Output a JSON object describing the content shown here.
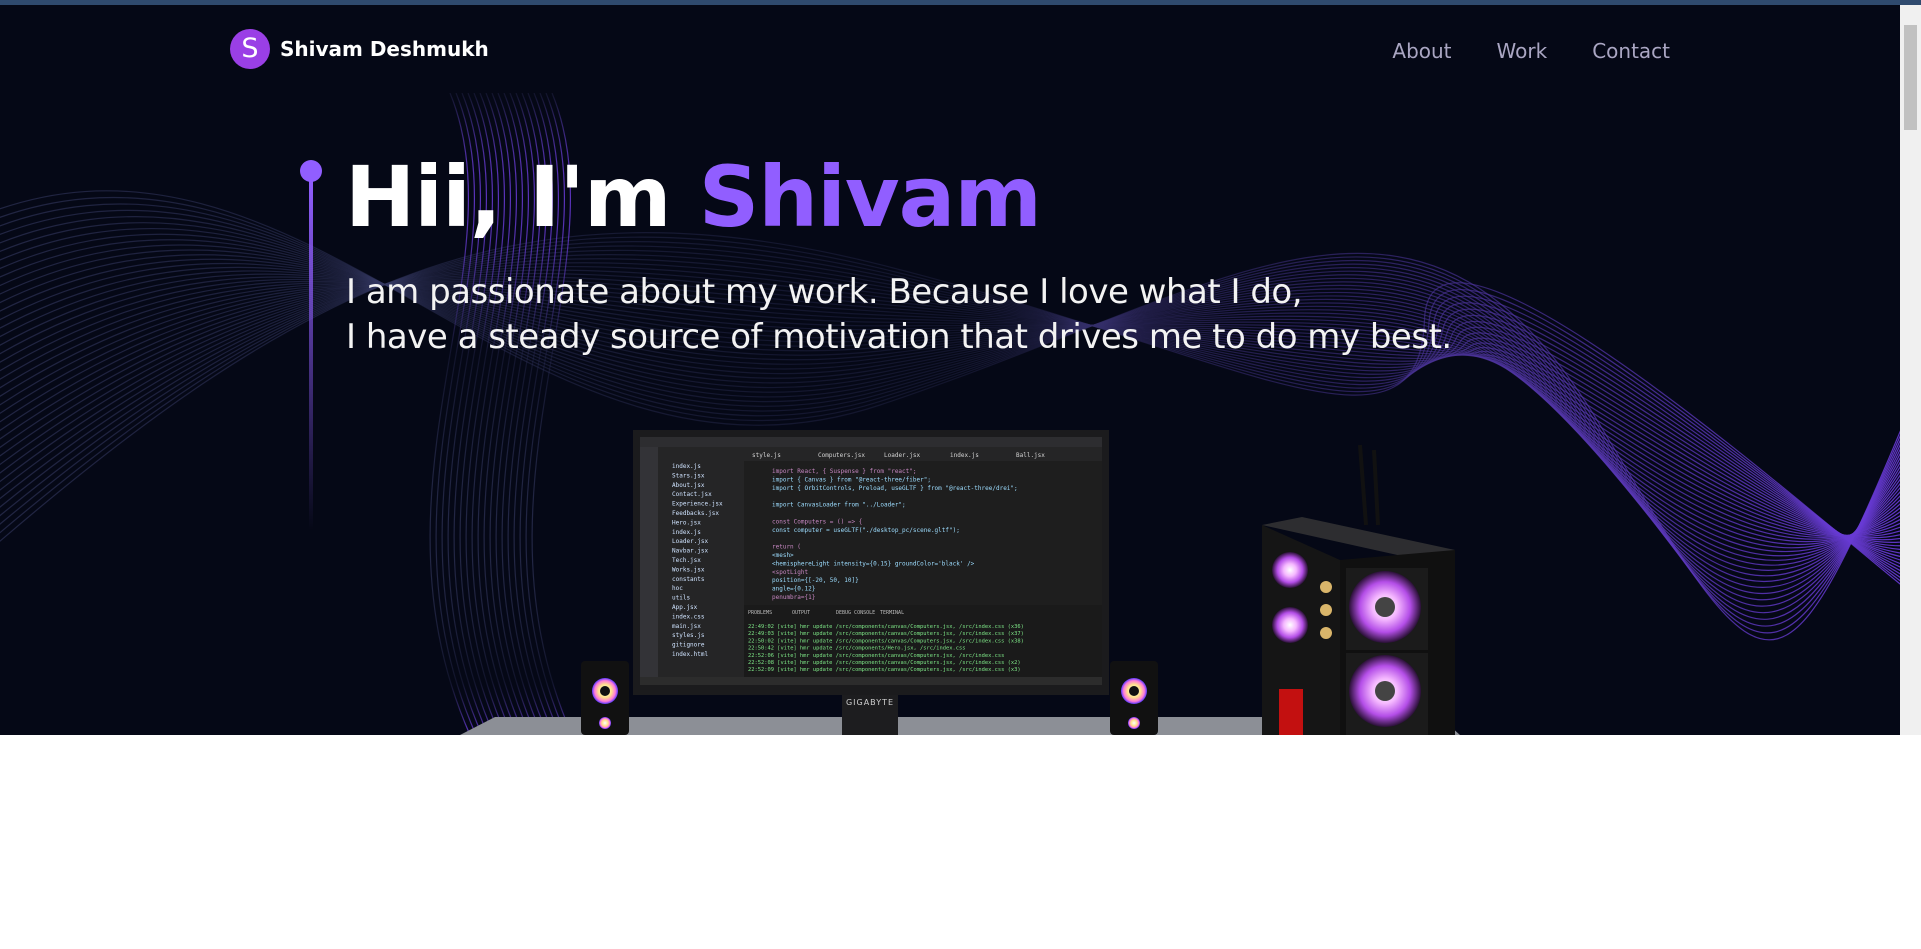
{
  "brand": {
    "initial": "S",
    "name": "Shivam Deshmukh"
  },
  "nav": {
    "items": [
      "About",
      "Work",
      "Contact"
    ]
  },
  "hero": {
    "greeting": "Hii, I'm ",
    "name": "Shivam",
    "line1": "I am passionate about my work. Because I love what I do,",
    "line2": "I have a steady source of motivation that drives me to do my best."
  },
  "scene": {
    "monitor_brand": "GIGABYTE",
    "editor_tabs": [
      "style.js",
      "Computers.jsx",
      "Loader.jsx",
      "index.js",
      "Ball.jsx"
    ],
    "code_lines": [
      "import React, { Suspense } from \"react\";",
      "import { Canvas } from \"@react-three/fiber\";",
      "import { OrbitControls, Preload, useGLTF } from \"@react-three/drei\";",
      "",
      "import CanvasLoader from \"../Loader\";",
      "",
      "const Computers = () => {",
      "  const computer = useGLTF(\"./desktop_pc/scene.gltf\");",
      "",
      "  return (",
      "    <mesh>",
      "      <hemisphereLight intensity={0.15} groundColor='black' />",
      "      <spotLight",
      "        position={[-20, 50, 10]}",
      "        angle={0.12}",
      "        penumbra={1}"
    ],
    "terminal_tabs": [
      "PROBLEMS",
      "OUTPUT",
      "DEBUG CONSOLE",
      "TERMINAL"
    ],
    "terminal_lines": [
      "22:49:02 [vite] hmr update /src/components/canvas/Computers.jsx, /src/index.css (x36)",
      "22:49:03 [vite] hmr update /src/components/canvas/Computers.jsx, /src/index.css (x37)",
      "22:50:02 [vite] hmr update /src/components/canvas/Computers.jsx, /src/index.css (x38)",
      "22:50:42 [vite] hmr update /src/components/Hero.jsx, /src/index.css",
      "22:52:06 [vite] hmr update /src/components/canvas/Computers.jsx, /src/index.css",
      "22:52:08 [vite] hmr update /src/components/canvas/Computers.jsx, /src/index.css (x2)",
      "22:52:09 [vite] hmr update /src/components/canvas/Computers.jsx, /src/index.css (x3)"
    ],
    "file_tree": [
      "index.js",
      "Stars.jsx",
      "About.jsx",
      "Contact.jsx",
      "Experience.jsx",
      "Feedbacks.jsx",
      "Hero.jsx",
      "index.js",
      "Loader.jsx",
      "Navbar.jsx",
      "Tech.jsx",
      "Works.jsx",
      "constants",
      "hoc",
      "utils",
      "App.jsx",
      "index.css",
      "main.jsx",
      "styles.js",
      "gitignore",
      "index.html"
    ]
  },
  "colors": {
    "background": "#050816",
    "accent": "#915eff",
    "nav_text": "#aaa6c3",
    "logo_circle": "#9a3fe6"
  }
}
